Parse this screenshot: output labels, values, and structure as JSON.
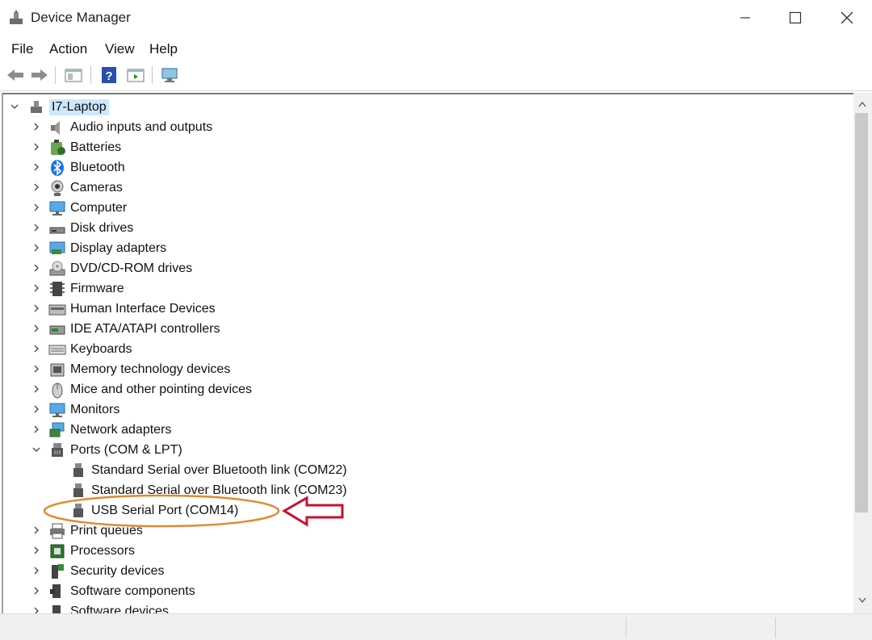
{
  "window": {
    "title": "Device Manager"
  },
  "menu": [
    "File",
    "Action",
    "View",
    "Help"
  ],
  "tree": {
    "root": "I7-Laptop",
    "categories": [
      "Audio inputs and outputs",
      "Batteries",
      "Bluetooth",
      "Cameras",
      "Computer",
      "Disk drives",
      "Display adapters",
      "DVD/CD-ROM drives",
      "Firmware",
      "Human Interface Devices",
      "IDE ATA/ATAPI controllers",
      "Keyboards",
      "Memory technology devices",
      "Mice and other pointing devices",
      "Monitors",
      "Network adapters",
      "Ports (COM & LPT)"
    ],
    "ports_children": [
      "Standard Serial over Bluetooth link (COM22)",
      "Standard Serial over Bluetooth link (COM23)",
      "USB Serial Port (COM14)"
    ],
    "categories_after": [
      "Print queues",
      "Processors",
      "Security devices",
      "Software components",
      "Software devices"
    ]
  },
  "colors": {
    "annotation_ellipse": "#e08a2e",
    "annotation_arrow": "#c8102e",
    "selection": "#cce8ff"
  }
}
